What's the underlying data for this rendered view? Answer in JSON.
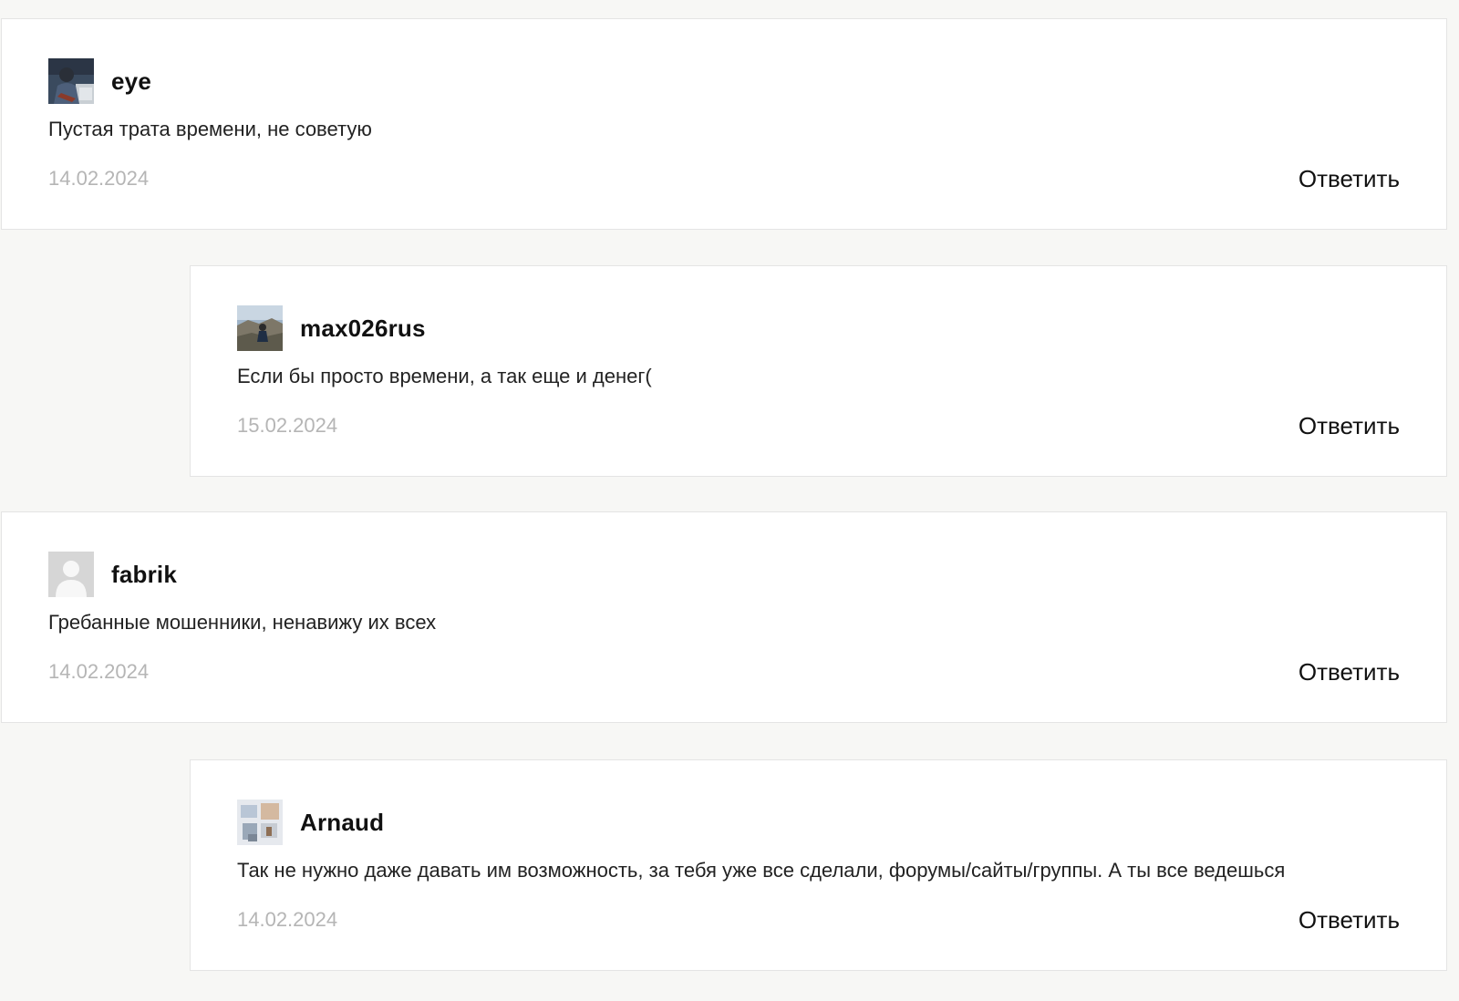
{
  "comments": [
    {
      "author": "eye",
      "text": "Пустая трата времени, не советую",
      "date": "14.02.2024",
      "reply_label": "Ответить",
      "avatar_icon": "user-photo-icon"
    },
    {
      "author": "max026rus",
      "text": "Если бы просто времени, а так еще и денег(",
      "date": "15.02.2024",
      "reply_label": "Ответить",
      "avatar_icon": "user-photo-icon"
    },
    {
      "author": "fabrik",
      "text": "Гребанные мошенники, ненавижу их всех",
      "date": "14.02.2024",
      "reply_label": "Ответить",
      "avatar_icon": "default-avatar-icon"
    },
    {
      "author": "Arnaud",
      "text": "Так не нужно даже давать им возможность, за тебя уже все сделали, форумы/сайты/группы. А ты все ведешься",
      "date": "14.02.2024",
      "reply_label": "Ответить",
      "avatar_icon": "user-photo-icon"
    }
  ],
  "colors": {
    "page_background": "#f7f7f5",
    "card_background": "#ffffff",
    "card_border": "#e4e4e4",
    "date_text": "#b5b5b5",
    "body_text": "#222222"
  }
}
